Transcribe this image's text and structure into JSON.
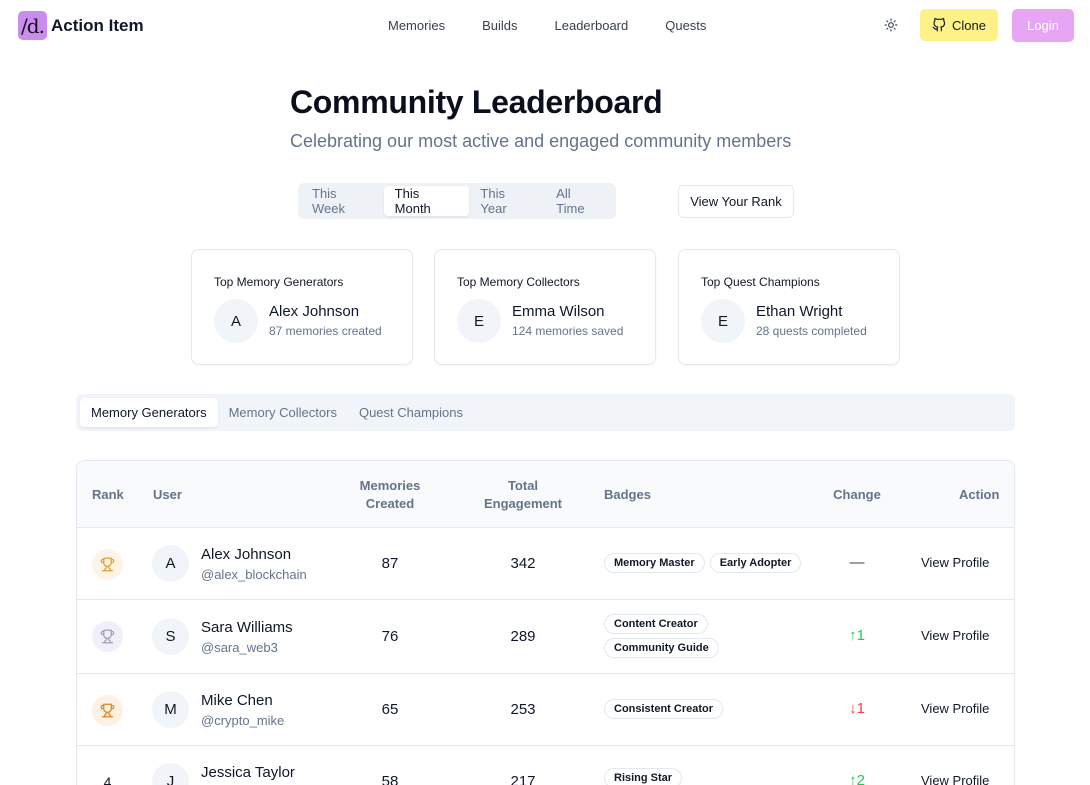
{
  "brand": {
    "mark": "/d.",
    "name": "Action Item",
    "mark_color": "#c98df0"
  },
  "nav": [
    "Memories",
    "Builds",
    "Leaderboard",
    "Quests"
  ],
  "header_actions": {
    "theme_icon": "sun-icon",
    "clone_label": "Clone",
    "clone_icon": "github-icon",
    "login_label": "Login"
  },
  "hero": {
    "title": "Community Leaderboard",
    "subtitle": "Celebrating our most active and engaged community members"
  },
  "period_tabs": {
    "items": [
      "This Week",
      "This Month",
      "This Year",
      "All Time"
    ],
    "active": "This Month"
  },
  "view_rank_label": "View Your Rank",
  "top_cards": [
    {
      "title": "Top Memory Generators",
      "initial": "A",
      "name": "Alex Johnson",
      "stat": "87 memories created"
    },
    {
      "title": "Top Memory Collectors",
      "initial": "E",
      "name": "Emma Wilson",
      "stat": "124 memories saved"
    },
    {
      "title": "Top Quest Champions",
      "initial": "E",
      "name": "Ethan Wright",
      "stat": "28 quests completed"
    }
  ],
  "category_tabs": {
    "items": [
      "Memory Generators",
      "Memory Collectors",
      "Quest Champions"
    ],
    "active": "Memory Generators"
  },
  "table": {
    "headers": {
      "rank": "Rank",
      "user": "User",
      "memories_1": "Memories",
      "memories_2": "Created",
      "engagement_1": "Total",
      "engagement_2": "Engagement",
      "badges": "Badges",
      "change": "Change",
      "action": "Action"
    },
    "rows": [
      {
        "rank": "1",
        "rank_icon": "trophy-icon",
        "rank_color": "#d9a23a",
        "rank_bg": "#fdf4e7",
        "initial": "A",
        "name": "Alex Johnson",
        "handle": "@alex_blockchain",
        "memories": "87",
        "engagement": "342",
        "badges": [
          "Memory Master",
          "Early Adopter"
        ],
        "change": "—",
        "change_color": "#374151",
        "action": "View Profile"
      },
      {
        "rank": "2",
        "rank_icon": "trophy-icon",
        "rank_color": "#9ca3af",
        "rank_bg": "#f3eefb",
        "initial": "S",
        "name": "Sara Williams",
        "handle": "@sara_web3",
        "memories": "76",
        "engagement": "289",
        "badges": [
          "Content Creator",
          "Community Guide"
        ],
        "change": "↑1",
        "change_color": "#22c55e",
        "action": "View Profile"
      },
      {
        "rank": "3",
        "rank_icon": "trophy-icon",
        "rank_color": "#d9862e",
        "rank_bg": "#fdf1e4",
        "initial": "M",
        "name": "Mike Chen",
        "handle": "@crypto_mike",
        "memories": "65",
        "engagement": "253",
        "badges": [
          "Consistent Creator"
        ],
        "change": "↓1",
        "change_color": "#ef4444",
        "action": "View Profile"
      },
      {
        "rank": "4",
        "initial": "J",
        "name": "Jessica Taylor",
        "handle": "",
        "memories": "58",
        "engagement": "217",
        "badges": [
          "Rising Star"
        ],
        "change": "↑2",
        "change_color": "#22c55e",
        "action": "View Profile"
      }
    ]
  }
}
